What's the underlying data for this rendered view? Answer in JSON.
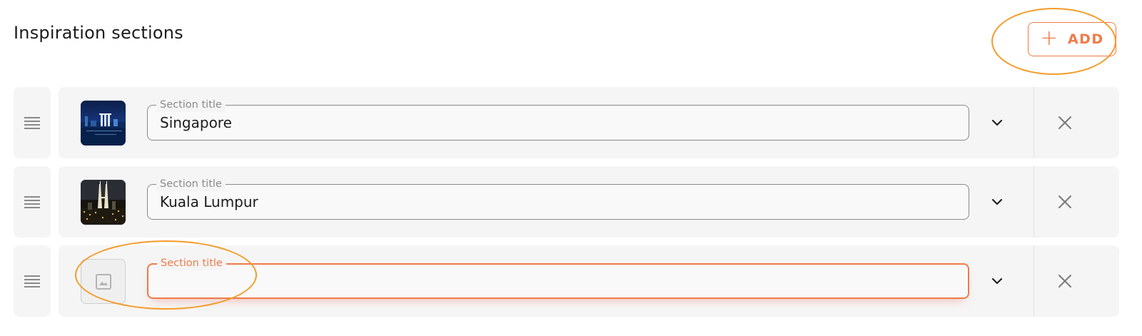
{
  "page": {
    "title": "Inspiration sections",
    "add_button_label": "ADD",
    "add_button_icon": "plus-icon",
    "accent_color": "#f07a48",
    "annotation_color": "#f59a28"
  },
  "sections": [
    {
      "label": "Section title",
      "value": "Singapore",
      "thumbnail": "singapore-night-skyline-photo"
    },
    {
      "label": "Section title",
      "value": "Kuala Lumpur",
      "thumbnail": "kuala-lumpur-petronas-towers-photo"
    },
    {
      "label": "Section title",
      "value": "",
      "thumbnail": "image-placeholder-icon",
      "focused": true
    }
  ],
  "icons": {
    "drag": "drag-handle-icon",
    "expand": "chevron-down-icon",
    "remove": "close-icon"
  }
}
